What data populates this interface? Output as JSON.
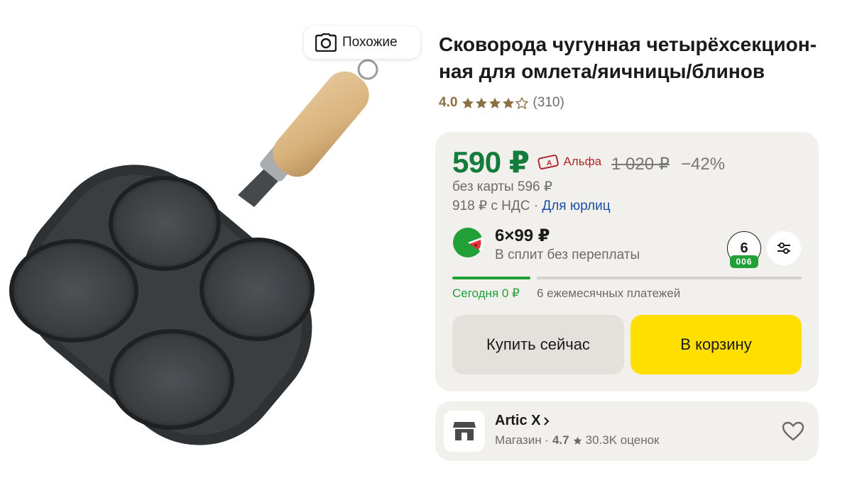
{
  "gallery": {
    "similar_label": "Похожие",
    "image_icon": "frying-pan-image"
  },
  "product": {
    "title": "Сковорода чугунная четырёхсекцион-ная для омлета/яичницы/блинов",
    "rating": "4.0",
    "rating_stars": 4,
    "reviews_count": "(310)"
  },
  "price": {
    "current": "590 ₽",
    "bank_label": "Альфа",
    "old": "1 020 ₽",
    "discount": "−42%",
    "without_card": "без карты 596 ₽",
    "vat_text": "918 ₽ с НДС · ",
    "legal_link": "Для юрлиц"
  },
  "split": {
    "amount": "6×99 ₽",
    "subtitle": "В сплит без переплаты",
    "months": "6",
    "months_badge": "006",
    "today": "Сегодня 0 ₽",
    "payments": "6 ежемесячных платежей"
  },
  "actions": {
    "buy_now": "Купить сейчас",
    "add_to_cart": "В корзину"
  },
  "shop": {
    "name": "Artic X",
    "type": "Магазин ·",
    "rating": "4.7",
    "reviews": "30.3K оценок"
  },
  "colors": {
    "price_green": "#137c3a",
    "split_green": "#21a038",
    "cart_yellow": "#ffdf00",
    "alfa_red": "#b3252c",
    "link_blue": "#1d4ea5"
  }
}
